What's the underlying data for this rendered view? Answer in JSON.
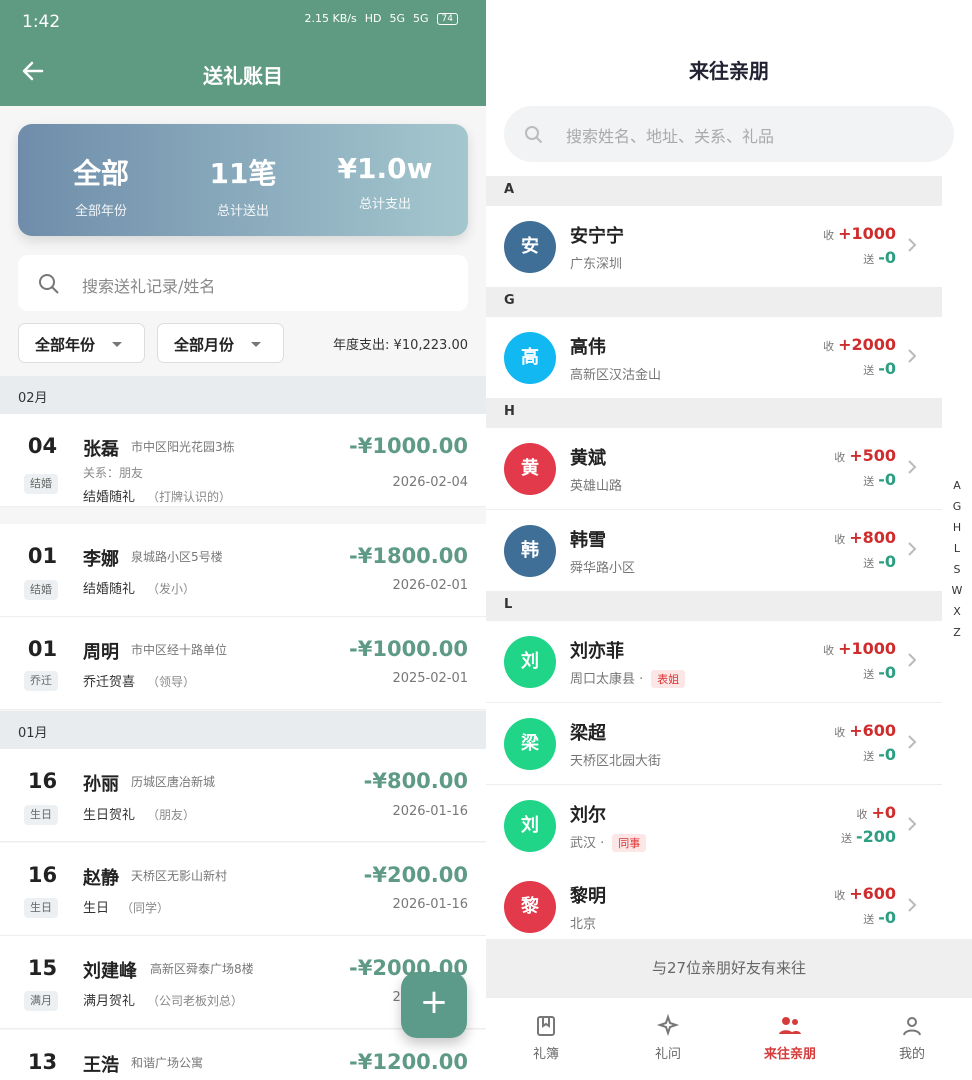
{
  "left": {
    "status": {
      "time": "1:42",
      "network": "2.15 KB/s",
      "hd": "HD",
      "signal1": "5G",
      "signal2": "5G",
      "battery": "74"
    },
    "title": "送礼账目",
    "summary": [
      {
        "value": "全部",
        "label": "全部年份"
      },
      {
        "value": "11笔",
        "label": "总计送出"
      },
      {
        "value": "¥1.0w",
        "label": "总计支出"
      }
    ],
    "search_placeholder": "搜索送礼记录/姓名",
    "filters": [
      "全部年份",
      "全部月份"
    ],
    "annual_spend": "年度支出: ¥10,223.00",
    "months": [
      "02月",
      "01月"
    ],
    "entries": [
      {
        "day": "04",
        "tag": "结婚",
        "name": "张磊",
        "address": "市中区阳光花园3栋",
        "relation_line": "关系：朋友",
        "item": "结婚随礼",
        "note": "（打牌认识的）",
        "amount": "-¥1000.00",
        "date": "2026-02-04"
      },
      {
        "day": "01",
        "tag": "结婚",
        "name": "李娜",
        "address": "泉城路小区5号楼",
        "item": "结婚随礼",
        "note": "（发小）",
        "amount": "-¥1800.00",
        "date": "2026-02-01"
      },
      {
        "day": "01",
        "tag": "乔迁",
        "name": "周明",
        "address": "市中区经十路单位",
        "item": "乔迁贺喜",
        "note": "（领导）",
        "amount": "-¥1000.00",
        "date": "2025-02-01"
      },
      {
        "day": "16",
        "tag": "生日",
        "name": "孙丽",
        "address": "历城区唐冶新城",
        "item": "生日贺礼",
        "note": "（朋友）",
        "amount": "-¥800.00",
        "date": "2026-01-16"
      },
      {
        "day": "16",
        "tag": "生日",
        "name": "赵静",
        "address": "天桥区无影山新村",
        "item": "生日",
        "note": "（同学）",
        "amount": "-¥200.00",
        "date": "2026-01-16"
      },
      {
        "day": "15",
        "tag": "满月",
        "name": "刘建峰",
        "address": "高新区舜泰广场8楼",
        "item": "满月贺礼",
        "note": "（公司老板刘总）",
        "amount": "-¥2000.00",
        "date": "2026-01-15"
      },
      {
        "day": "13",
        "tag": "",
        "name": "王浩",
        "address": "和谐广场公寓",
        "item": "",
        "note": "",
        "amount": "-¥1200.00",
        "date": ""
      }
    ],
    "fab": "+"
  },
  "right": {
    "title": "来往亲朋",
    "search_placeholder": "搜索姓名、地址、关系、礼品",
    "sections": [
      "A",
      "G",
      "H",
      "L"
    ],
    "contacts": [
      {
        "avatar": "安",
        "color": "#3f6f96",
        "name": "安宁宁",
        "place": "广东深圳",
        "relation": "",
        "received": "+1000",
        "sent": "-0"
      },
      {
        "avatar": "高",
        "color": "#12b8f1",
        "name": "高伟",
        "place": "高新区汉沽金山",
        "relation": "",
        "received": "+2000",
        "sent": "-0"
      },
      {
        "avatar": "黄",
        "color": "#e33a4b",
        "name": "黄斌",
        "place": "英雄山路",
        "relation": "",
        "received": "+500",
        "sent": "-0"
      },
      {
        "avatar": "韩",
        "color": "#3f6f96",
        "name": "韩雪",
        "place": "舜华路小区",
        "relation": "",
        "received": "+800",
        "sent": "-0"
      },
      {
        "avatar": "刘",
        "color": "#20d488",
        "name": "刘亦菲",
        "place": "周口太康县 ·",
        "relation": "表姐",
        "received": "+1000",
        "sent": "-0"
      },
      {
        "avatar": "梁",
        "color": "#20d488",
        "name": "梁超",
        "place": "天桥区北园大街",
        "relation": "",
        "received": "+600",
        "sent": "-0"
      },
      {
        "avatar": "刘",
        "color": "#20d488",
        "name": "刘尔",
        "place": "武汉 ·",
        "relation": "同事",
        "received": "+0",
        "sent": "-200"
      },
      {
        "avatar": "黎",
        "color": "#e33a4b",
        "name": "黎明",
        "place": "北京",
        "relation": "",
        "received": "+600",
        "sent": "-0"
      }
    ],
    "labels": {
      "receive": "收",
      "send": "送"
    },
    "index": [
      "A",
      "G",
      "H",
      "L",
      "S",
      "W",
      "X",
      "Z"
    ],
    "footer": "与27位亲朋好友有来往",
    "tabs": [
      "礼簿",
      "礼问",
      "来往亲朋",
      "我的"
    ]
  }
}
